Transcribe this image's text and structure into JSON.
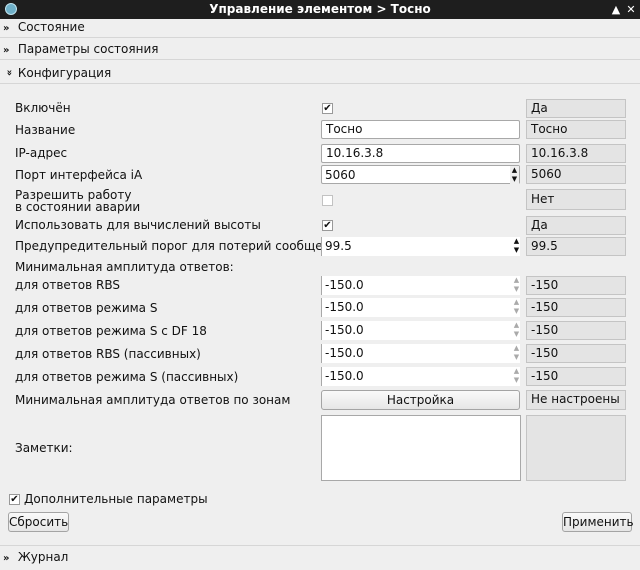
{
  "window": {
    "title": "Управление элементом > Тосно"
  },
  "sections": {
    "state": "Состояние",
    "state_params": "Параметры состояния",
    "config": "Конфигурация",
    "journal": "Журнал"
  },
  "form": {
    "enabled": {
      "label": "Включён",
      "checked": true,
      "display": "Да"
    },
    "name": {
      "label": "Название",
      "value": "Тосно",
      "display": "Тосно"
    },
    "ip": {
      "label": "IP-адрес",
      "value": "10.16.3.8",
      "display": "10.16.3.8"
    },
    "port": {
      "label": "Порт интерфейса iA",
      "value": "5060",
      "display": "5060"
    },
    "allow_alarm": {
      "label_line1": "Разрешить работу",
      "label_line2": "в состоянии аварии",
      "checked": false,
      "display": "Нет"
    },
    "use_altitude": {
      "label": "Использовать для вычислений высоты",
      "checked": true,
      "display": "Да"
    },
    "warn_threshold": {
      "label": "Предупредительный порог для потерий сообщений (%)",
      "value": "99.5",
      "display": "99.5"
    },
    "min_amp_header": "Минимальная амплитуда ответов:",
    "amps": [
      {
        "label": "для ответов RBS",
        "value": "-150.0",
        "display": "-150"
      },
      {
        "label": "для ответов режима S",
        "value": "-150.0",
        "display": "-150"
      },
      {
        "label": "для ответов режима S с DF 18",
        "value": "-150.0",
        "display": "-150"
      },
      {
        "label": "для ответов RBS (пассивных)",
        "value": "-150.0",
        "display": "-150"
      },
      {
        "label": "для ответов режима S (пассивных)",
        "value": "-150.0",
        "display": "-150"
      }
    ],
    "zones": {
      "label": "Минимальная амплитуда ответов по зонам",
      "button": "Настройка",
      "display": "Не настроены"
    },
    "notes": {
      "label": "Заметки:",
      "value": ""
    },
    "extra": {
      "label": "Дополнительные параметры",
      "checked": true
    },
    "reset_label": "Сбросить",
    "apply_label": "Применить"
  }
}
